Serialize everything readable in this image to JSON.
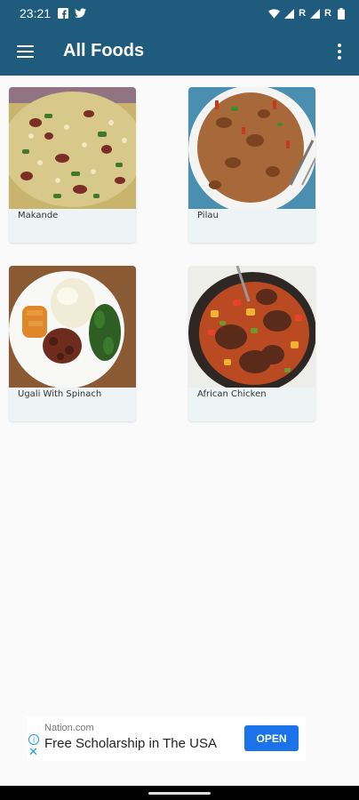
{
  "status_bar": {
    "time": "23:21",
    "icons": [
      "facebook-icon",
      "twitter-icon",
      "wifi-icon",
      "signal-icon",
      "signal-icon",
      "battery-icon"
    ],
    "roaming_1": "R",
    "roaming_2": "R"
  },
  "app_bar": {
    "title": "All Foods",
    "menu_icon": "hamburger-menu-icon",
    "overflow_icon": "more-vert-icon"
  },
  "foods": [
    {
      "name": "Makande"
    },
    {
      "name": "Pilau"
    },
    {
      "name": "Ugali With Spinach"
    },
    {
      "name": "African Chicken"
    }
  ],
  "ad": {
    "source": "Nation.com",
    "headline": "Free Scholarship in The USA",
    "cta": "OPEN"
  },
  "colors": {
    "primary": "#1f5b7c",
    "card_bg": "#eef3f5",
    "ad_button": "#1a73e8"
  }
}
